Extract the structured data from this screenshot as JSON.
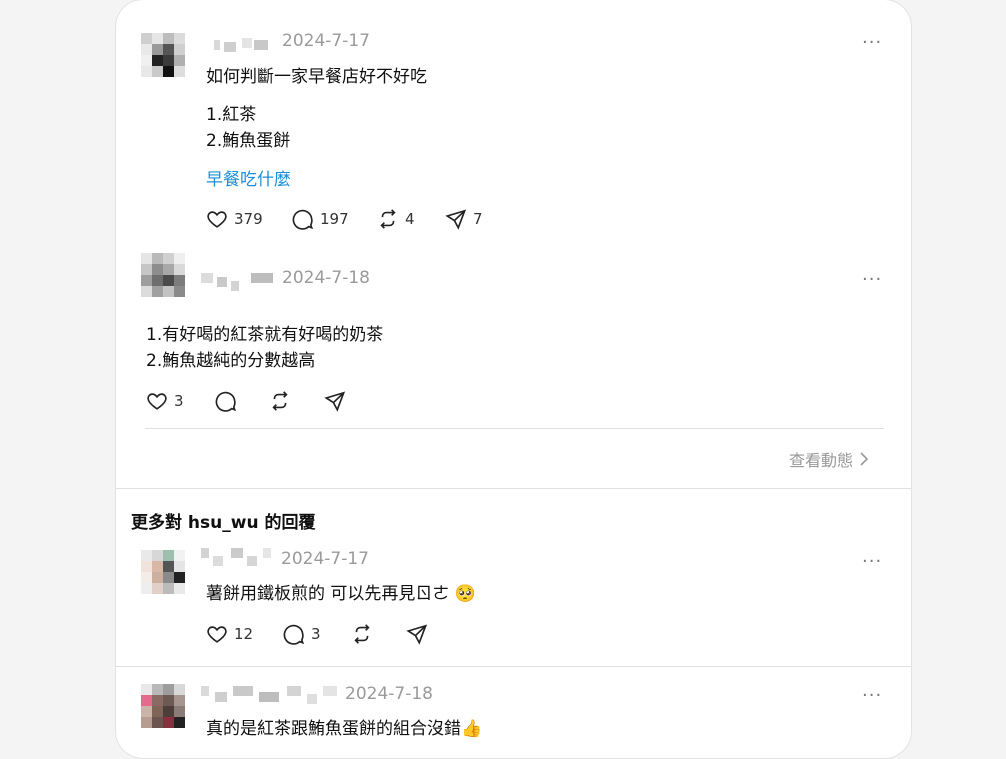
{
  "post": {
    "date": "2024-7-17",
    "title": "如何判斷一家早餐店好不好吃",
    "lines": [
      "1.紅茶",
      "2.鮪魚蛋餅"
    ],
    "tag": "早餐吃什麼",
    "likes": "379",
    "comments": "197",
    "reposts": "4",
    "shares": "7"
  },
  "reply1": {
    "date": "2024-7-18",
    "lines": [
      "1.有好喝的紅茶就有好喝的奶茶",
      "2.鮪魚越純的分數越高"
    ],
    "likes": "3"
  },
  "view_activity": "查看動態",
  "section_title": "更多對 hsu_wu 的回覆",
  "reply2": {
    "date": "2024-7-17",
    "text": "薯餅用鐵板煎的 可以先再見ㄖㄜ 🥺",
    "likes": "12",
    "comments": "3"
  },
  "reply3": {
    "date": "2024-7-18",
    "text": "真的是紅茶跟鮪魚蛋餅的組合沒錯👍"
  },
  "more_glyph": "···"
}
